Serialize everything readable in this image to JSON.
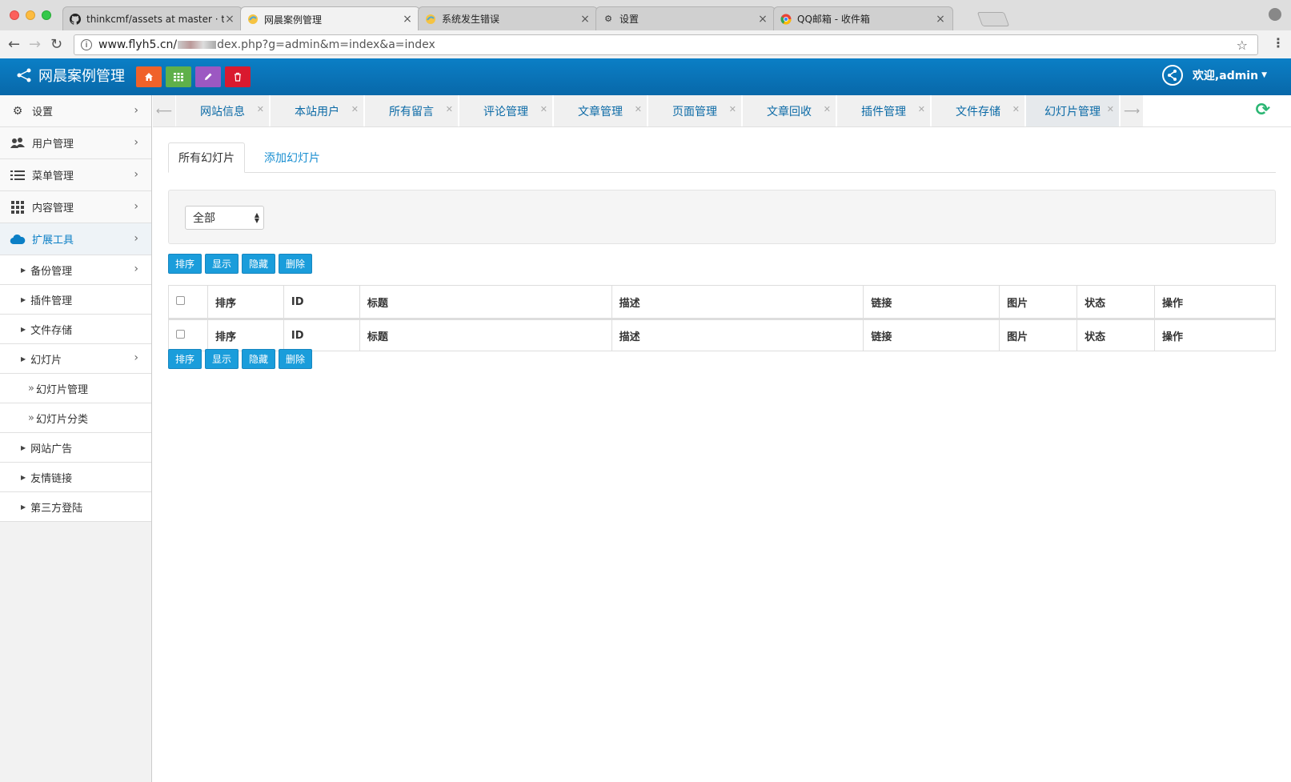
{
  "browser": {
    "tabs": [
      {
        "title": "thinkcmf/assets at master · thi",
        "favicon": "github-icon",
        "active": false
      },
      {
        "title": "网晨案例管理",
        "favicon": "site-icon",
        "active": true
      },
      {
        "title": "系统发生错误",
        "favicon": "site-icon",
        "active": false
      },
      {
        "title": "设置",
        "favicon": "gear-icon",
        "active": false
      },
      {
        "title": "QQ邮箱 - 收件箱",
        "favicon": "chrome-icon",
        "active": false
      }
    ],
    "url_host": "www.flyh5.cn/",
    "url_rest": "dex.php?g=admin&m=index&a=index"
  },
  "header": {
    "brand": "网晨案例管理",
    "user": "欢迎,admin",
    "buttons": [
      {
        "name": "home-button",
        "icon": "home-icon",
        "color": "#f0622a"
      },
      {
        "name": "grid-button",
        "icon": "grid-icon",
        "color": "#5fb04a"
      },
      {
        "name": "edit-button",
        "icon": "pencil-icon",
        "color": "#9c58c2"
      },
      {
        "name": "delete-button",
        "icon": "trash-icon",
        "color": "#d9192f"
      }
    ]
  },
  "sidebar": {
    "items": [
      {
        "label": "设置",
        "icon": "gear-icon"
      },
      {
        "label": "用户管理",
        "icon": "users-icon"
      },
      {
        "label": "菜单管理",
        "icon": "list-icon"
      },
      {
        "label": "内容管理",
        "icon": "grid-icon"
      },
      {
        "label": "扩展工具",
        "icon": "cloud-icon"
      }
    ],
    "sub": {
      "backup": "备份管理",
      "plugins": "插件管理",
      "storage": "文件存储",
      "slides": "幻灯片",
      "slide_manage": "幻灯片管理",
      "slide_category": "幻灯片分类",
      "ads": "网站广告",
      "links": "友情链接",
      "oauth": "第三方登陆"
    }
  },
  "ctabs": [
    "网站信息",
    "本站用户",
    "所有留言",
    "评论管理",
    "文章管理",
    "页面管理",
    "文章回收",
    "插件管理",
    "文件存储",
    "幻灯片管理"
  ],
  "main": {
    "subtab_all": "所有幻灯片",
    "subtab_add": "添加幻灯片",
    "filter_value": "全部",
    "actions": {
      "sort": "排序",
      "show": "显示",
      "hide": "隐藏",
      "delete": "删除"
    },
    "columns": [
      "排序",
      "ID",
      "标题",
      "描述",
      "链接",
      "图片",
      "状态",
      "操作"
    ],
    "footer_row": [
      "排序",
      "ID",
      "标题",
      "描述",
      "链接",
      "图片",
      "状态",
      "操作"
    ]
  }
}
